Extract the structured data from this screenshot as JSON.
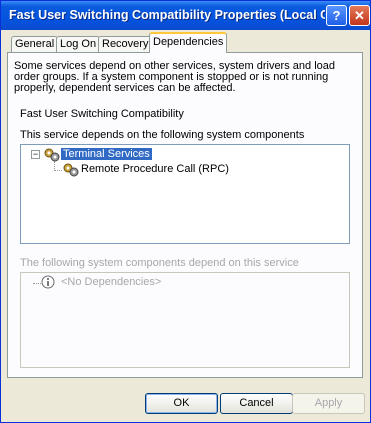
{
  "window": {
    "title": "Fast User Switching Compatibility Properties (Local Co...",
    "help_label": "?",
    "close_label": "✕"
  },
  "tabs": [
    {
      "label": "General",
      "active": false
    },
    {
      "label": "Log On",
      "active": false
    },
    {
      "label": "Recovery",
      "active": false
    },
    {
      "label": "Dependencies",
      "active": true
    }
  ],
  "dependencies": {
    "description": "Some services depend on other services, system drivers and load order groups. If a system component is stopped or is not running properly, dependent services can be affected.",
    "service_name": "Fast User Switching Compatibility",
    "depends_on_label": "This service depends on the following system components",
    "depends_on_tree": {
      "root": {
        "label": "Terminal Services",
        "icon": "gears-icon",
        "expanded": true,
        "selected": true
      },
      "children": [
        {
          "label": "Remote Procedure Call (RPC)",
          "icon": "gears-icon"
        }
      ]
    },
    "dependents_label": "The following system components depend on this service",
    "dependents_tree": {
      "label": "<No Dependencies>",
      "icon": "info-icon"
    }
  },
  "buttons": {
    "ok": "OK",
    "cancel": "Cancel",
    "apply": "Apply"
  },
  "colors": {
    "titlebar": "#0554e0",
    "selection": "#316ac5",
    "dialog_bg": "#ece9d8"
  }
}
